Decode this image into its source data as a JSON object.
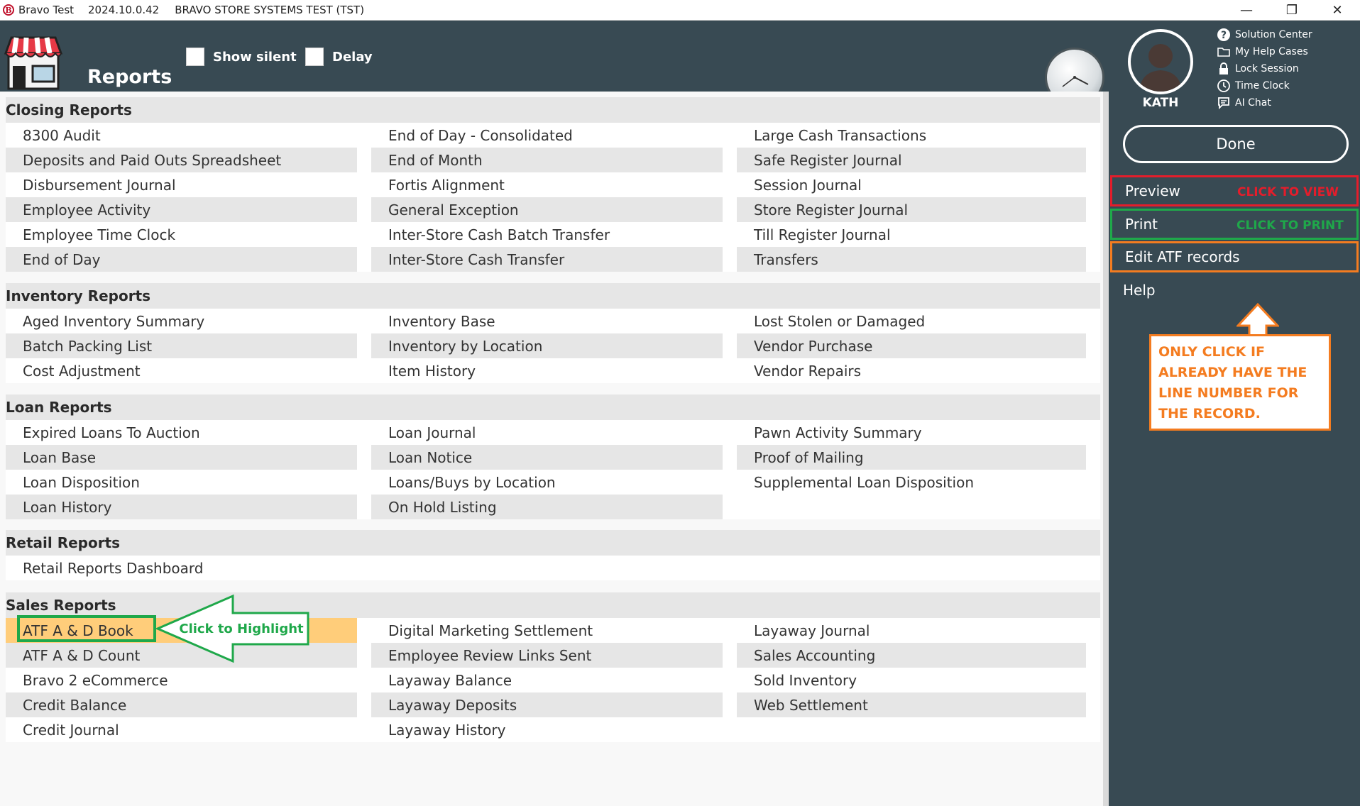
{
  "titlebar": {
    "app_name": "Bravo Test",
    "version": "2024.10.0.42",
    "environment": "BRAVO STORE SYSTEMS TEST (TST)",
    "logo_letter": "B",
    "minimize": "—",
    "restore": "❐",
    "close": "✕"
  },
  "header": {
    "title": "Reports",
    "show_silent_label": "Show silent",
    "delay_label": "Delay"
  },
  "user": {
    "name": "KATH"
  },
  "side_links": [
    {
      "label": "Solution Center",
      "icon": "help-circle-icon"
    },
    {
      "label": "My Help Cases",
      "icon": "folder-icon"
    },
    {
      "label": "Lock Session",
      "icon": "lock-icon"
    },
    {
      "label": "Time Clock",
      "icon": "clock-icon"
    },
    {
      "label": "AI Chat",
      "icon": "chat-icon"
    }
  ],
  "actions": {
    "done": "Done",
    "preview": "Preview",
    "print": "Print",
    "edit_atf": "Edit ATF records",
    "help": "Help"
  },
  "annotations": {
    "click_to_view": "CLICK TO VIEW",
    "click_to_print": "CLICK TO PRINT",
    "click_to_highlight": "Click to Highlight",
    "only_click_note": "ONLY CLICK IF ALREADY HAVE THE LINE NUMBER FOR THE RECORD."
  },
  "sections": [
    {
      "title": "Closing Reports",
      "columns": [
        [
          "8300 Audit",
          "Deposits and Paid Outs Spreadsheet",
          "Disbursement Journal",
          "Employee Activity",
          "Employee Time Clock",
          "End of Day"
        ],
        [
          "End of Day - Consolidated",
          "End of Month",
          "Fortis Alignment",
          "General Exception",
          "Inter-Store Cash Batch Transfer",
          "Inter-Store Cash Transfer"
        ],
        [
          "Large Cash Transactions",
          "Safe Register Journal",
          "Session Journal",
          "Store Register Journal",
          "Till Register Journal",
          "Transfers"
        ]
      ]
    },
    {
      "title": "Inventory Reports",
      "columns": [
        [
          "Aged Inventory Summary",
          "Batch Packing List",
          "Cost Adjustment"
        ],
        [
          "Inventory Base",
          "Inventory by Location",
          "Item History"
        ],
        [
          "Lost Stolen or Damaged",
          "Vendor Purchase",
          "Vendor Repairs"
        ]
      ]
    },
    {
      "title": "Loan Reports",
      "columns": [
        [
          "Expired Loans To Auction",
          "Loan Base",
          "Loan Disposition",
          "Loan History"
        ],
        [
          "Loan Journal",
          "Loan Notice",
          "Loans/Buys by Location",
          "On Hold Listing"
        ],
        [
          "Pawn Activity Summary",
          "Proof of Mailing",
          "Supplemental Loan Disposition",
          ""
        ]
      ]
    },
    {
      "title": "Retail Reports",
      "columns": [
        [
          "Retail Reports Dashboard"
        ],
        [
          ""
        ],
        [
          ""
        ]
      ]
    },
    {
      "title": "Sales Reports",
      "selected": "ATF A & D Book",
      "columns": [
        [
          "ATF A & D Book",
          "ATF A & D Count",
          "Bravo 2 eCommerce",
          "Credit Balance",
          "Credit Journal"
        ],
        [
          "Digital Marketing Settlement",
          "Employee Review Links Sent",
          "Layaway Balance",
          "Layaway Deposits",
          "Layaway History"
        ],
        [
          "Layaway Journal",
          "Sales Accounting",
          "Sold Inventory",
          "Web Settlement",
          ""
        ]
      ]
    }
  ],
  "colors": {
    "header_bg": "#384a53",
    "highlight_selected": "#ffcd7a",
    "annotation_red": "#e41d2b",
    "annotation_green": "#1fa84a",
    "annotation_orange": "#f47c20"
  }
}
